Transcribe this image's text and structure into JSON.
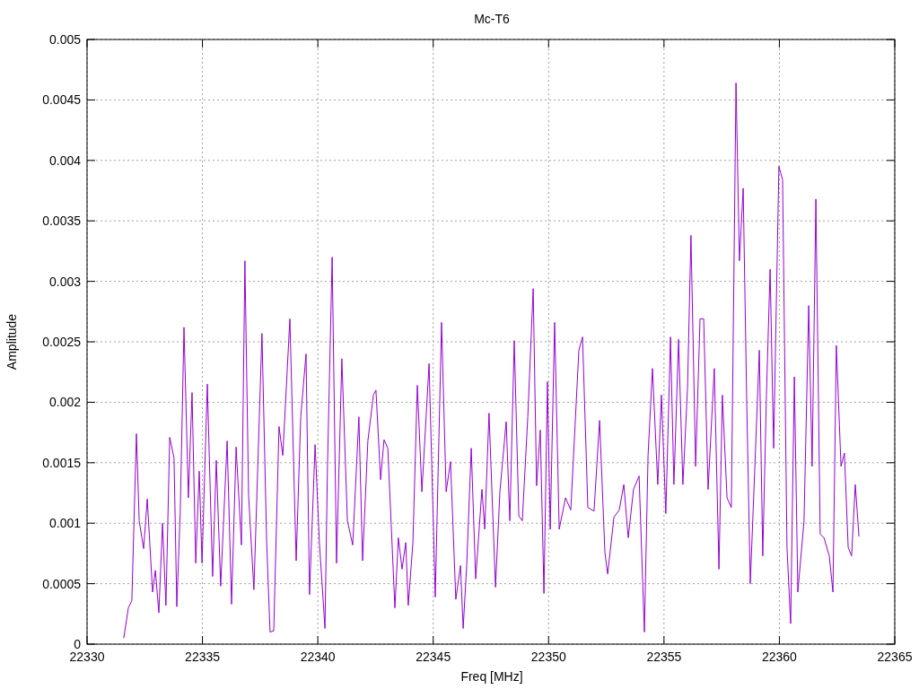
{
  "chart_data": {
    "type": "line",
    "title": "Mc-T6",
    "xlabel": "Freq [MHz]",
    "ylabel": "Amplitude",
    "xlim": [
      22330,
      22365
    ],
    "ylim": [
      0,
      0.005
    ],
    "grid": true,
    "xticks": [
      22330,
      22335,
      22340,
      22345,
      22350,
      22355,
      22360,
      22365
    ],
    "yticks": [
      0,
      0.0005,
      0.001,
      0.0015,
      0.002,
      0.0025,
      0.003,
      0.0035,
      0.004,
      0.0045,
      0.005
    ],
    "x": [
      22331.59,
      22331.79,
      22331.94,
      22332.14,
      22332.26,
      22332.45,
      22332.61,
      22332.84,
      22332.96,
      22333.11,
      22333.27,
      22333.42,
      22333.58,
      22333.77,
      22333.89,
      22334.04,
      22334.2,
      22334.39,
      22334.55,
      22334.71,
      22334.86,
      22334.98,
      22335.21,
      22335.44,
      22335.6,
      22335.79,
      22336.07,
      22336.26,
      22336.46,
      22336.69,
      22336.84,
      22337.0,
      22337.23,
      22337.58,
      22337.78,
      22337.93,
      22338.09,
      22338.32,
      22338.48,
      22338.79,
      22339.06,
      22339.26,
      22339.49,
      22339.64,
      22339.88,
      22340.07,
      22340.31,
      22340.42,
      22340.62,
      22340.81,
      22341.04,
      22341.28,
      22341.51,
      22341.78,
      22341.94,
      22342.17,
      22342.41,
      22342.52,
      22342.72,
      22342.87,
      22343.03,
      22343.18,
      22343.34,
      22343.49,
      22343.65,
      22343.81,
      22343.92,
      22344.12,
      22344.31,
      22344.51,
      22344.82,
      22345.09,
      22345.36,
      22345.56,
      22345.75,
      22345.98,
      22346.18,
      22346.3,
      22346.45,
      22346.65,
      22346.84,
      22347.11,
      22347.23,
      22347.42,
      22347.7,
      22347.89,
      22348.16,
      22348.32,
      22348.51,
      22348.71,
      22348.86,
      22349.1,
      22349.33,
      22349.48,
      22349.64,
      22349.8,
      22349.95,
      22350.07,
      22350.26,
      22350.46,
      22350.73,
      22350.96,
      22351.31,
      22351.47,
      22351.7,
      22351.97,
      22352.21,
      22352.44,
      22352.56,
      22352.83,
      22353.06,
      22353.26,
      22353.45,
      22353.68,
      22353.92,
      22354.15,
      22354.31,
      22354.5,
      22354.73,
      22354.89,
      22355.08,
      22355.28,
      22355.43,
      22355.63,
      22355.82,
      22356.02,
      22356.17,
      22356.37,
      22356.56,
      22356.72,
      22356.91,
      22357.18,
      22357.38,
      22357.53,
      22357.73,
      22357.92,
      22358.12,
      22358.27,
      22358.43,
      22358.58,
      22358.74,
      22358.97,
      22359.13,
      22359.28,
      22359.44,
      22359.6,
      22359.75,
      22359.98,
      22360.14,
      22360.33,
      22360.49,
      22360.65,
      22360.8,
      22361.07,
      22361.27,
      22361.42,
      22361.58,
      22361.77,
      22361.93,
      22362.16,
      22362.32,
      22362.47,
      22362.67,
      22362.82,
      22362.98,
      22363.13,
      22363.29,
      22363.45
    ],
    "series": [
      {
        "color": "#9400d3",
        "values": [
          5e-05,
          0.0003,
          0.00036,
          0.00174,
          0.00102,
          0.00079,
          0.0012,
          0.00043,
          0.00061,
          0.00026,
          0.001,
          0.00032,
          0.00171,
          0.00154,
          0.00031,
          0.00111,
          0.00262,
          0.00121,
          0.00208,
          0.00067,
          0.00143,
          0.00067,
          0.00215,
          0.00056,
          0.00152,
          0.00048,
          0.00168,
          0.00033,
          0.00163,
          0.00082,
          0.00317,
          0.00123,
          0.00045,
          0.00257,
          0.00085,
          0.0001,
          0.00011,
          0.0018,
          0.00156,
          0.00269,
          0.00069,
          0.00188,
          0.0024,
          0.00041,
          0.00165,
          0.00084,
          0.00013,
          0.00147,
          0.0032,
          0.00067,
          0.00236,
          0.00102,
          0.00082,
          0.00188,
          0.00069,
          0.00168,
          0.00206,
          0.0021,
          0.00136,
          0.00169,
          0.00162,
          0.00099,
          0.0003,
          0.00088,
          0.00062,
          0.00084,
          0.00032,
          0.00084,
          0.00214,
          0.00126,
          0.00232,
          0.00039,
          0.00266,
          0.00126,
          0.00151,
          0.00037,
          0.00065,
          0.00013,
          0.00065,
          0.00162,
          0.00054,
          0.00128,
          0.00095,
          0.00191,
          0.00047,
          0.00126,
          0.00184,
          0.00102,
          0.00251,
          0.00106,
          0.00102,
          0.00188,
          0.00294,
          0.00131,
          0.00177,
          0.00042,
          0.00217,
          0.00095,
          0.00266,
          0.00095,
          0.00121,
          0.00111,
          0.00243,
          0.00254,
          0.00113,
          0.0011,
          0.00185,
          0.00076,
          0.00058,
          0.00105,
          0.00111,
          0.00132,
          0.00088,
          0.00128,
          0.00139,
          0.0001,
          0.00156,
          0.00228,
          0.00132,
          0.00206,
          0.00108,
          0.00254,
          0.00132,
          0.00252,
          0.00132,
          0.00212,
          0.00338,
          0.00147,
          0.00269,
          0.00269,
          0.00128,
          0.00228,
          0.00062,
          0.00206,
          0.00121,
          0.00113,
          0.00464,
          0.00317,
          0.00377,
          0.00206,
          0.0005,
          0.00162,
          0.00243,
          0.00073,
          0.00206,
          0.0031,
          0.00162,
          0.00395,
          0.00384,
          0.0008,
          0.00017,
          0.00221,
          0.00043,
          0.00102,
          0.0028,
          0.00147,
          0.00368,
          0.00091,
          0.00088,
          0.00073,
          0.00043,
          0.00247,
          0.00147,
          0.00158,
          0.0008,
          0.00073,
          0.00132,
          0.00089
        ]
      }
    ]
  }
}
